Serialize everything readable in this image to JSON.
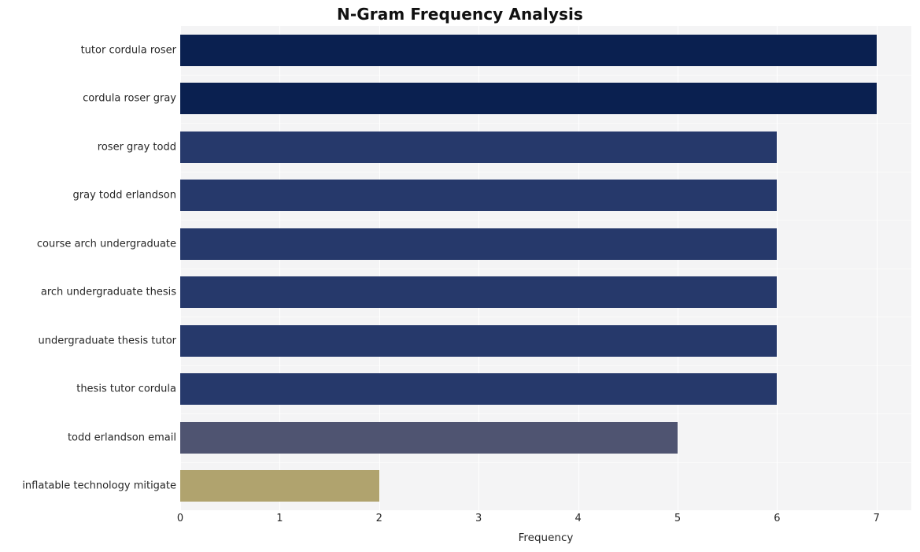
{
  "chart_data": {
    "type": "bar",
    "orientation": "horizontal",
    "title": "N-Gram Frequency Analysis",
    "xlabel": "Frequency",
    "ylabel": "",
    "categories": [
      "tutor cordula roser",
      "cordula roser gray",
      "roser gray todd",
      "gray todd erlandson",
      "course arch undergraduate",
      "arch undergraduate thesis",
      "undergraduate thesis tutor",
      "thesis tutor cordula",
      "todd erlandson email",
      "inflatable technology mitigate"
    ],
    "values": [
      7,
      7,
      6,
      6,
      6,
      6,
      6,
      6,
      5,
      2
    ],
    "bar_colors": [
      "#0a2050",
      "#0a2050",
      "#26396b",
      "#26396b",
      "#26396b",
      "#26396b",
      "#26396b",
      "#26396b",
      "#4f5471",
      "#b0a36e"
    ],
    "xlim": [
      0,
      7.35
    ],
    "xticks": [
      0,
      1,
      2,
      3,
      4,
      5,
      6,
      7
    ],
    "xtick_labels": [
      "0",
      "1",
      "2",
      "3",
      "4",
      "5",
      "6",
      "7"
    ],
    "grid": true,
    "grid_axis": "x",
    "legend": false,
    "plot_background": "#f4f4f5",
    "grid_color": "#ffffff",
    "figure_background": "#ffffff",
    "title_color": "#111111",
    "tick_label_color": "#262626"
  }
}
